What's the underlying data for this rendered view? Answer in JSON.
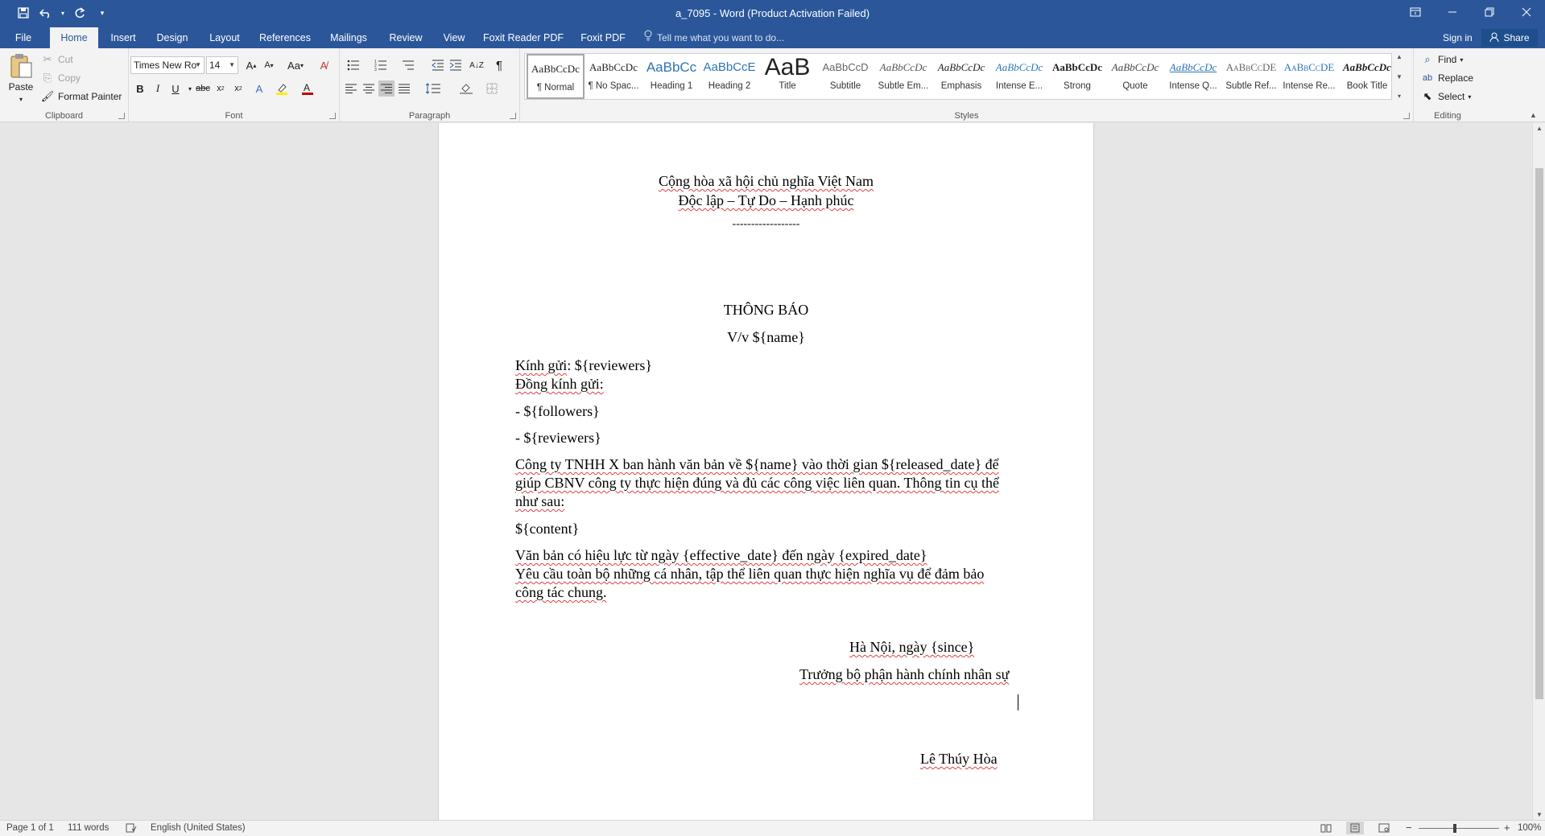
{
  "window": {
    "title": "a_7095 - Word (Product Activation Failed)",
    "qat": [
      "save-icon",
      "undo-icon",
      "redo-icon",
      "customize-icon"
    ]
  },
  "tabs": [
    "File",
    "Home",
    "Insert",
    "Design",
    "Layout",
    "References",
    "Mailings",
    "Review",
    "View",
    "Foxit Reader PDF",
    "Foxit PDF"
  ],
  "active_tab": "Home",
  "tell_me": "Tell me what you want to do...",
  "sign_in": "Sign in",
  "share": "Share",
  "clipboard": {
    "paste": "Paste",
    "cut": "Cut",
    "copy": "Copy",
    "format_painter": "Format Painter",
    "label": "Clipboard"
  },
  "font": {
    "name": "Times New Ro",
    "size": "14",
    "label": "Font",
    "change_case": "Aa"
  },
  "paragraph": {
    "label": "Paragraph"
  },
  "styles": {
    "label": "Styles",
    "items": [
      {
        "preview": "AaBbCcDc",
        "name": "¶ Normal"
      },
      {
        "preview": "AaBbCcDc",
        "name": "¶ No Spac..."
      },
      {
        "preview": "AaBbCc",
        "name": "Heading 1"
      },
      {
        "preview": "AaBbCcE",
        "name": "Heading 2"
      },
      {
        "preview": "AaB",
        "name": "Title"
      },
      {
        "preview": "AaBbCcD",
        "name": "Subtitle"
      },
      {
        "preview": "AaBbCcDc",
        "name": "Subtle Em..."
      },
      {
        "preview": "AaBbCcDc",
        "name": "Emphasis"
      },
      {
        "preview": "AaBbCcDc",
        "name": "Intense E..."
      },
      {
        "preview": "AaBbCcDc",
        "name": "Strong"
      },
      {
        "preview": "AaBbCcDc",
        "name": "Quote"
      },
      {
        "preview": "AaBbCcDc",
        "name": "Intense Q..."
      },
      {
        "preview": "AaBbCcDE",
        "name": "Subtle Ref..."
      },
      {
        "preview": "AaBbCcDE",
        "name": "Intense Re..."
      },
      {
        "preview": "AaBbCcDc",
        "name": "Book Title"
      }
    ]
  },
  "editing": {
    "label": "Editing",
    "find": "Find",
    "replace": "Replace",
    "select": "Select"
  },
  "document": {
    "header1": "Cộng hòa xã hội chủ nghĩa Việt Nam",
    "header2": "Độc lập – Tự Do – Hạnh phúc",
    "divider": "------------------",
    "title": "THÔNG BÁO",
    "subject": "V/v ${name}",
    "to_label": "Kính gửi",
    "to_value": ": ${reviewers}",
    "cc": "Đồng kính gửi:",
    "follower_line": "- ${followers}",
    "reviewer_line": "- ${reviewers}",
    "body1": "Công ty TNHH X ban hành văn bản về ${name} vào thời gian ${released_date} để",
    "body2": "giúp CBNV công ty thực hiện đúng và đủ các công việc liên quan. Thông tin cụ thể",
    "body3": "như sau:",
    "content": "${content}",
    "validity": "Văn bản có hiệu lực từ ngày {effective_date} đến ngày {expired_date}",
    "request1": "Yêu cầu toàn bộ những cá nhân, tập thể liên quan thực hiện nghĩa vụ để đảm bảo",
    "request2": "công tác chung.",
    "place_date": "Hà Nội, ngày {since}",
    "position": "Trưởng bộ phận hành chính nhân sự",
    "signer": "Lê Thúy Hòa"
  },
  "status": {
    "page": "Page 1 of 1",
    "words": "111 words",
    "language": "English (United States)",
    "zoom": "100%"
  },
  "colors": {
    "accent": "#2b579a",
    "ribbon": "#f3f3f3",
    "spellcheck": "#e04040"
  }
}
